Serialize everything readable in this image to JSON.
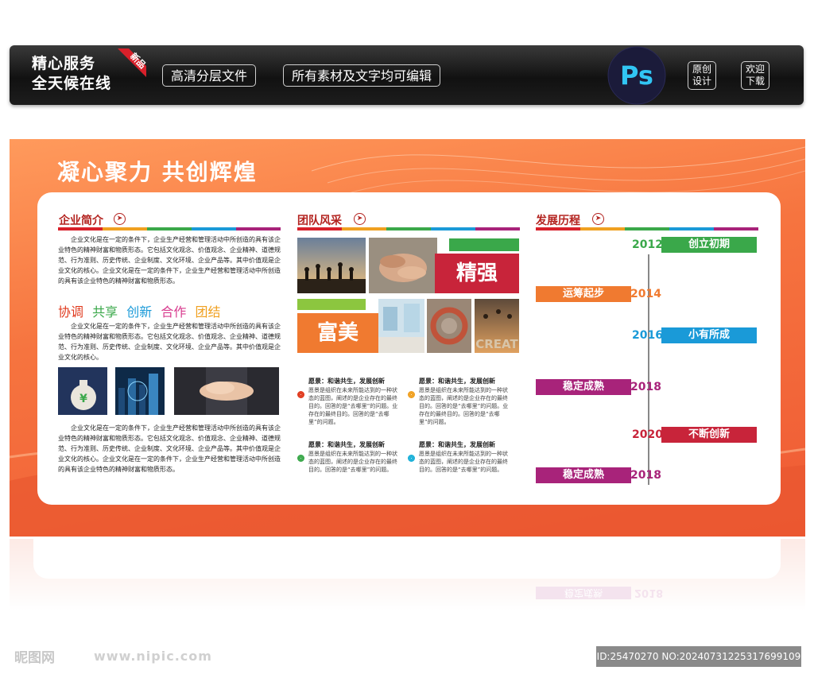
{
  "banner": {
    "service_line1": "精心服务",
    "service_line2": "全天候在线",
    "ribbon": "新品",
    "pill1": "高清分层文件",
    "pill2": "所有素材及文字均可编辑",
    "ps": "Ps",
    "btn1_line1": "原创",
    "btn1_line2": "设计",
    "btn2_line1": "欢迎",
    "btn2_line2": "下载"
  },
  "board": {
    "title": "凝心聚力  共创辉煌",
    "intro": {
      "title": "企业简介",
      "para1": "企业文化是在一定的条件下，企业生产经营和管理活动中所创造的具有该企业特色的精神财富和物质形态。它包括文化观念、价值观念、企业精神、道德规范、行为准则、历史传统、企业制度、文化环境、企业产品等。其中价值观是企业文化的核心。企业文化是在一定的条件下，企业生产经营和管理活动中所创造的具有该企业特色的精神财富和物质形态。",
      "keywords": [
        {
          "text": "协调",
          "color": "#e03a1e"
        },
        {
          "text": "共享",
          "color": "#3aa84a"
        },
        {
          "text": "创新",
          "color": "#1a9ad8"
        },
        {
          "text": "合作",
          "color": "#d83b8e"
        },
        {
          "text": "团结",
          "color": "#f0a020"
        }
      ],
      "para2": "企业文化是在一定的条件下，企业生产经营和管理活动中所创造的具有该企业特色的精神财富和物质形态。它包括文化观念、价值观念、企业精神、道德规范、行为准则、历史传统、企业制度、文化环境、企业产品等。其中价值观是企业文化的核心。",
      "para3": "企业文化是在一定的条件下，企业生产经营和管理活动中所创造的具有该企业特色的精神财富和物质形态。它包括文化观念、价值观念、企业精神、道德规范、行为准则、历史传统、企业制度、文化环境、企业产品等。其中价值观是企业文化的核心。企业文化是在一定的条件下，企业生产经营和管理活动中所创造的具有该企业特色的精神财富和物质形态。"
    },
    "team": {
      "title": "团队风采",
      "word1": "精强",
      "word2": "富美",
      "creat": "CREAT",
      "items": [
        {
          "head": "愿景：和谐共生，发展创新",
          "body": "愿景是组织在未来所能达到的一种状态的蓝图，阐述的是企业存在的最终目的。回答的是“去哪里”的问题。业存在的最终目的。回答的是“去哪里”的问题。",
          "color": "#e03a1e"
        },
        {
          "head": "愿景：和谐共生，发展创新",
          "body": "愿景是组织在未来所能达到的一种状态的蓝图，阐述的是企业存在的最终目的。回答的是“去哪里”的问题。业存在的最终目的。回答的是“去哪里”的问题。",
          "color": "#f0a020"
        },
        {
          "head": "愿景：和谐共生，发展创新",
          "body": "愿景是组织在未来所能达到的一种状态的蓝图，阐述的是企业存在的最终目的。回答的是“去哪里”的问题。",
          "color": "#3aa84a"
        },
        {
          "head": "愿景：和谐共生，发展创新",
          "body": "愿景是组织在未来所能达到的一种状态的蓝图，阐述的是企业存在的最终目的。回答的是“去哪里”的问题。",
          "color": "#1ab0d8"
        }
      ]
    },
    "history": {
      "title": "发展历程",
      "events": [
        {
          "year": "2012",
          "label": "创立初期",
          "year_color": "#3aa84a",
          "label_color": "#3aa84a"
        },
        {
          "year": "2014",
          "label": "运筹起步",
          "year_color": "#f07a30",
          "label_color": "#f07a30"
        },
        {
          "year": "2016",
          "label": "小有所成",
          "year_color": "#1a9ad8",
          "label_color": "#1a9ad8"
        },
        {
          "year": "2018",
          "label": "稳定成熟",
          "year_color": "#a8237a",
          "label_color": "#a8237a"
        },
        {
          "year": "2020",
          "label": "不断创新",
          "year_color": "#c8243a",
          "label_color": "#c8243a"
        },
        {
          "year": "2018",
          "label": "稳定成熟",
          "year_color": "#a8237a",
          "label_color": "#a8237a"
        }
      ]
    }
  },
  "reflection": {
    "label": "稳定成熟",
    "year": "2018"
  },
  "footer": {
    "logo": "昵图网",
    "url": "www.nipic.com",
    "id": "ID:25470270 NO:20240731225317699109"
  }
}
